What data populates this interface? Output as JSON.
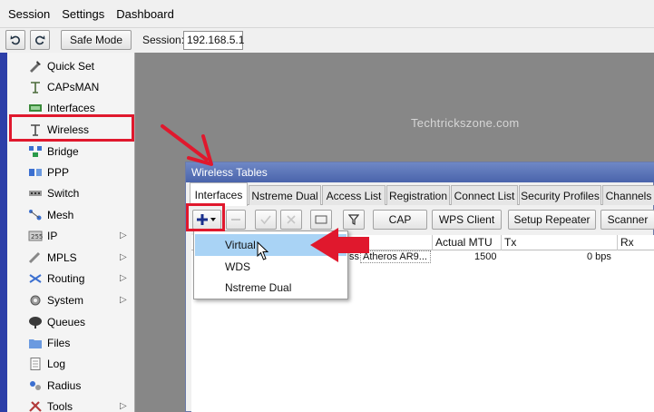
{
  "menu": {
    "session": "Session",
    "settings": "Settings",
    "dashboard": "Dashboard"
  },
  "toolbar": {
    "undo_icon": "undo-icon",
    "redo_icon": "redo-icon",
    "safe_mode": "Safe Mode",
    "session_label": "Session:",
    "session_value": "192.168.5.1"
  },
  "sidebar": {
    "items": [
      {
        "label": "Quick Set",
        "icon": "quick-set-icon",
        "submenu": false
      },
      {
        "label": "CAPsMAN",
        "icon": "capsman-icon",
        "submenu": false
      },
      {
        "label": "Interfaces",
        "icon": "interfaces-icon",
        "submenu": false
      },
      {
        "label": "Wireless",
        "icon": "wireless-icon",
        "submenu": false
      },
      {
        "label": "Bridge",
        "icon": "bridge-icon",
        "submenu": false
      },
      {
        "label": "PPP",
        "icon": "ppp-icon",
        "submenu": false
      },
      {
        "label": "Switch",
        "icon": "switch-icon",
        "submenu": false
      },
      {
        "label": "Mesh",
        "icon": "mesh-icon",
        "submenu": false
      },
      {
        "label": "IP",
        "icon": "ip-icon",
        "submenu": true
      },
      {
        "label": "MPLS",
        "icon": "mpls-icon",
        "submenu": true
      },
      {
        "label": "Routing",
        "icon": "routing-icon",
        "submenu": true
      },
      {
        "label": "System",
        "icon": "system-icon",
        "submenu": true
      },
      {
        "label": "Queues",
        "icon": "queues-icon",
        "submenu": false
      },
      {
        "label": "Files",
        "icon": "files-icon",
        "submenu": false
      },
      {
        "label": "Log",
        "icon": "log-icon",
        "submenu": false
      },
      {
        "label": "Radius",
        "icon": "radius-icon",
        "submenu": false
      },
      {
        "label": "Tools",
        "icon": "tools-icon",
        "submenu": true
      }
    ]
  },
  "workspace": {
    "watermark": "Techtrickszone.com"
  },
  "window": {
    "title": "Wireless Tables",
    "tabs": [
      "Interfaces",
      "Nstreme Dual",
      "Access List",
      "Registration",
      "Connect List",
      "Security Profiles",
      "Channels"
    ],
    "active_tab": "Interfaces",
    "buttons": {
      "cap": "CAP",
      "wps_client": "WPS Client",
      "setup_repeater": "Setup Repeater",
      "scanner": "Scanner"
    },
    "columns": {
      "actual_mtu": "Actual MTU",
      "tx": "Tx",
      "rx": "Rx"
    },
    "row": {
      "type_fragment": "ss",
      "chip": "Atheros AR9...",
      "actual_mtu": "1500",
      "tx": "0 bps"
    }
  },
  "dropdown": {
    "items": [
      "Virtual",
      "WDS",
      "Nstreme Dual"
    ],
    "selected": "Virtual"
  },
  "annotations": {
    "color": "#e0182d"
  }
}
